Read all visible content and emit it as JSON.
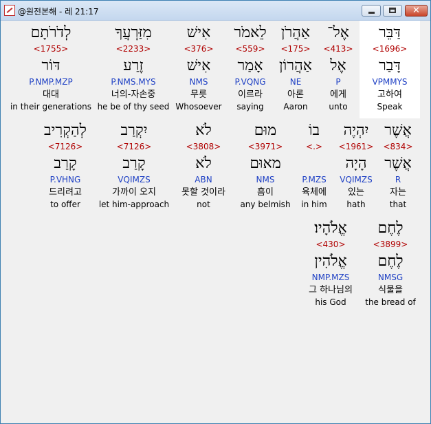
{
  "window": {
    "title": "@원전본해 - 레 21:17"
  },
  "rows": [
    {
      "words": [
        {
          "hebrew": "דַּבֵּר",
          "strong": "<1696>",
          "lemma": "דָּבַר",
          "parse": "VPMMYS",
          "korean": "고하여",
          "english": "Speak",
          "selected": true
        },
        {
          "hebrew": "אֶל־",
          "strong": "<413>",
          "lemma": "אֶל",
          "parse": "P",
          "korean": "에게",
          "english": "unto"
        },
        {
          "hebrew": "אַהֲרֹן",
          "strong": "<175>",
          "lemma": "אַהֲרוֹן",
          "parse": "NE",
          "korean": "아론",
          "english": "Aaron"
        },
        {
          "hebrew": "לֵאמֹר",
          "strong": "<559>",
          "lemma": "אָמַר",
          "parse": "P.VQNG",
          "korean": "이르라",
          "english": "saying"
        },
        {
          "hebrew": "אִישׁ",
          "strong": "<376>",
          "lemma": "אִישׁ",
          "parse": "NMS",
          "korean": "무릇",
          "english": "Whosoever"
        },
        {
          "hebrew": "מִזַּרְעֲךָ",
          "strong": "<2233>",
          "lemma": "זֶרַע",
          "parse": "P.NMS.MYS",
          "korean": "너의-자손중",
          "english": "he be of thy seed"
        },
        {
          "hebrew": "לְדֹרֹתָם",
          "strong": "<1755>",
          "lemma": "דּוֹר",
          "parse": "P.NMP.MZP",
          "korean": "대대",
          "english": "in their generations"
        }
      ]
    },
    {
      "words": [
        {
          "hebrew": "אֲשֶׁר",
          "strong": "<834>",
          "lemma": "אֲשֶׁר",
          "parse": "R",
          "korean": "자는",
          "english": "that"
        },
        {
          "hebrew": "יִהְיֶה",
          "strong": "<1961>",
          "lemma": "הָיָה",
          "parse": "VQIMZS",
          "korean": "있는",
          "english": "hath"
        },
        {
          "hebrew": "בוֹ",
          "strong": "<.>",
          "lemma": "",
          "parse": "P.MZS",
          "korean": "육체에",
          "english": "in him"
        },
        {
          "hebrew": "מוּם",
          "strong": "<3971>",
          "lemma": "מאוּם",
          "parse": "NMS",
          "korean": "흠이",
          "english": "any belmish"
        },
        {
          "hebrew": "לֹא",
          "strong": "<3808>",
          "lemma": "לֹא",
          "parse": "ABN",
          "korean": "못할 것이라",
          "english": "not"
        },
        {
          "hebrew": "יִקְרַב",
          "strong": "<7126>",
          "lemma": "קָרַב",
          "parse": "VQIMZS",
          "korean": "가까이 오지",
          "english": "let him-approach"
        },
        {
          "hebrew": "לְהַקְרִיב",
          "strong": "<7126>",
          "lemma": "קָרַב",
          "parse": "P.VHNG",
          "korean": "드리려고",
          "english": "to offer"
        }
      ]
    },
    {
      "words": [
        {
          "hebrew": "לֶחֶם",
          "strong": "<3899>",
          "lemma": "לֶחֶם",
          "parse": "NMSG",
          "korean": "식물을",
          "english": "the bread of"
        },
        {
          "hebrew": "אֱלֹהָיו׃",
          "strong": "<430>",
          "lemma": "אֱלֹהִין",
          "parse": "NMP.MZS",
          "korean": "그 하나님의",
          "english": "his God"
        }
      ]
    }
  ]
}
